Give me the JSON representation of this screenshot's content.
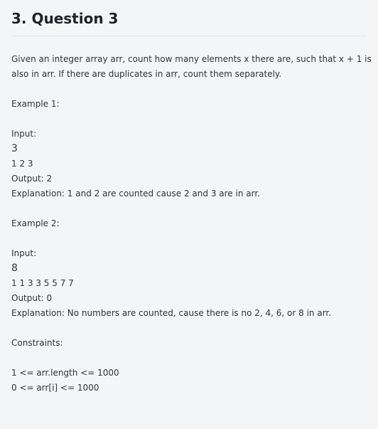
{
  "header": {
    "title": "3. Question 3"
  },
  "description": {
    "line1": "Given an integer array arr, count how many elements x there are, such that x + 1 is",
    "line2": "also in arr. If there are duplicates in arr, count them separately."
  },
  "example1": {
    "heading": "Example 1:",
    "input_label": "Input:",
    "input_n": "3",
    "input_arr": "1 2 3",
    "output": "Output: 2",
    "explanation": "Explanation: 1 and 2 are counted cause 2 and 3 are in arr."
  },
  "example2": {
    "heading": "Example 2:",
    "input_label": "Input:",
    "input_n": "8",
    "input_arr": "1 1 3 3 5 5 7 7",
    "output": "Output: 0",
    "explanation": "Explanation: No numbers are counted, cause there is no 2, 4, 6, or 8 in arr."
  },
  "constraints": {
    "heading": "Constraints:",
    "items": [
      "1 <= arr.length <= 1000",
      "0 <= arr[i] <= 1000"
    ]
  }
}
